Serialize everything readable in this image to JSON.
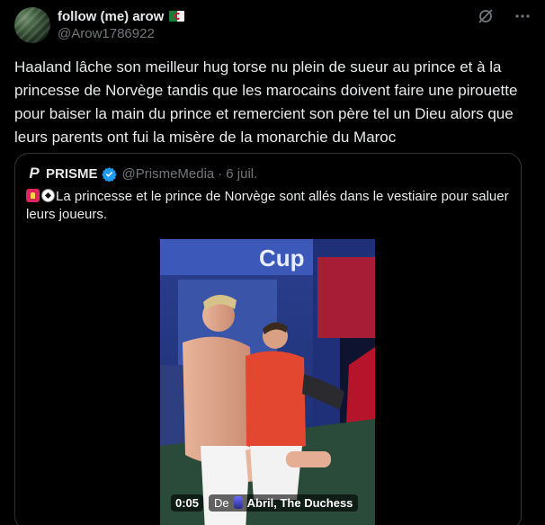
{
  "author": {
    "display_name": "follow (me) arow",
    "handle": "@Arow1786922"
  },
  "icons": {
    "grok": "grok-icon",
    "more": "more-icon",
    "verified": "verified-badge-icon",
    "flag": "algeria-flag-icon",
    "siren": "siren-emoji-icon",
    "ball": "soccer-ball-emoji-icon"
  },
  "tweet": {
    "text": "Haaland lâche son meilleur hug torse nu plein de sueur au prince et à la princesse de Norvège tandis que les marocains doivent faire une pirouette pour baiser la main du prince et remercient son père tel un Dieu alors que leurs parents ont fui la misère de la monarchie du Maroc"
  },
  "quote": {
    "logo": "P",
    "name": "PRISME",
    "handle": "@PrismeMedia",
    "separator": "·",
    "date": "6 juil.",
    "text": "La princesse et le prince de Norvège sont allés dans le vestiaire pour saluer leurs joueurs.",
    "media": {
      "timecode": "0:05",
      "source_prefix": "De",
      "source_name": "Abril, The Duchess"
    }
  },
  "colors": {
    "background": "#000000",
    "text": "#e7e9ea",
    "secondary": "#71767b",
    "border": "#2f3336",
    "verified": "#1d9bf0"
  }
}
